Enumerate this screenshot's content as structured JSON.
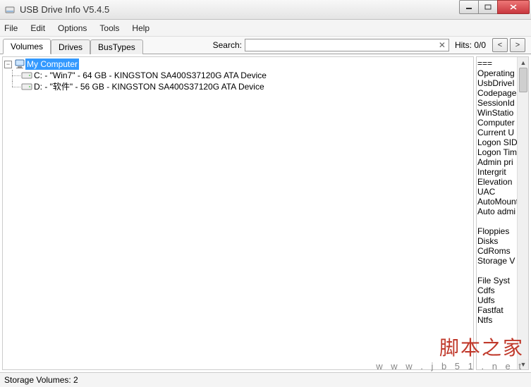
{
  "window": {
    "title": "USB Drive Info V5.4.5"
  },
  "menu": {
    "file": "File",
    "edit": "Edit",
    "options": "Options",
    "tools": "Tools",
    "help": "Help"
  },
  "tabs": {
    "volumes": "Volumes",
    "drives": "Drives",
    "bustypes": "BusTypes"
  },
  "search": {
    "label": "Search:",
    "hits_label": "Hits:",
    "hits_value": "0/0",
    "prev": "<",
    "next": ">"
  },
  "tree": {
    "root": "My Computer",
    "items": [
      "C: - \"Win7\" - 64 GB - KINGSTON SA400S37120G ATA Device",
      "D: - \"软件\" - 56 GB - KINGSTON SA400S37120G ATA Device"
    ]
  },
  "info_lines": [
    "       ===",
    "Operating",
    "UsbDriveI",
    "Codepages",
    "SessionId",
    "WinStatio",
    "Computer ",
    "Current U",
    "Logon SID",
    "Logon Tim",
    "Admin pri",
    "Intergrit",
    "Elevation",
    "UAC",
    "AutoMount",
    "Auto admi",
    "",
    "Floppies",
    "Disks",
    "CdRoms",
    "Storage V",
    "",
    "File Syst",
    "Cdfs",
    "Udfs",
    "Fastfat",
    "Ntfs"
  ],
  "status": {
    "text": "Storage Volumes: 2"
  },
  "watermark": {
    "cn": "脚本之家",
    "url": "w w w . j b 5 1 . n e t"
  }
}
